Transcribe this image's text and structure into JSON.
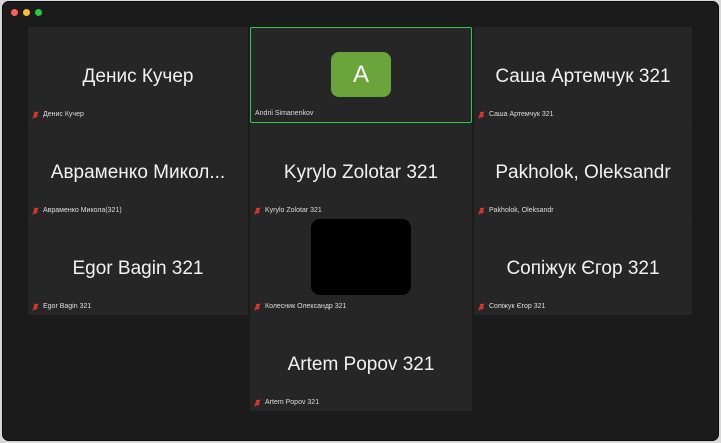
{
  "window": {
    "controls": [
      "close",
      "minimize",
      "maximize"
    ]
  },
  "participants": [
    {
      "display_name": "Денис Кучер",
      "label": "Денис Кучер",
      "state": "muted"
    },
    {
      "avatar_letter": "A",
      "label": "Andrii Simanenkov",
      "state": "active-speaker",
      "avatar_color": "#6aa43a"
    },
    {
      "display_name": "Саша Артемчук 321",
      "label": "Саша Артемчук 321",
      "state": "muted"
    },
    {
      "display_name": "Авраменко Микол...",
      "label": "Авраменко Микола(321)",
      "state": "muted"
    },
    {
      "display_name": "Kyrylo Zolotar 321",
      "label": "Kyrylo Zolotar 321",
      "state": "muted"
    },
    {
      "display_name": "Pakholok, Oleksandr",
      "label": "Pakholok, Oleksandr",
      "state": "muted"
    },
    {
      "display_name": "Egor Bagin 321",
      "label": "Egor Bagin 321",
      "state": "muted"
    },
    {
      "label": "Колесник Олександр 321",
      "state": "muted",
      "video": "black"
    },
    {
      "display_name": "Сопіжук Єгор 321",
      "label": "Сопіжук Єгор 321",
      "state": "muted"
    },
    {
      "display_name": "Artem Popov 321",
      "label": "Artem Popov 321",
      "state": "muted"
    }
  ],
  "colors": {
    "background": "#1b1b1b",
    "tile": "#262626",
    "active_border": "#34c759",
    "muted_icon": "#ff3b30"
  }
}
